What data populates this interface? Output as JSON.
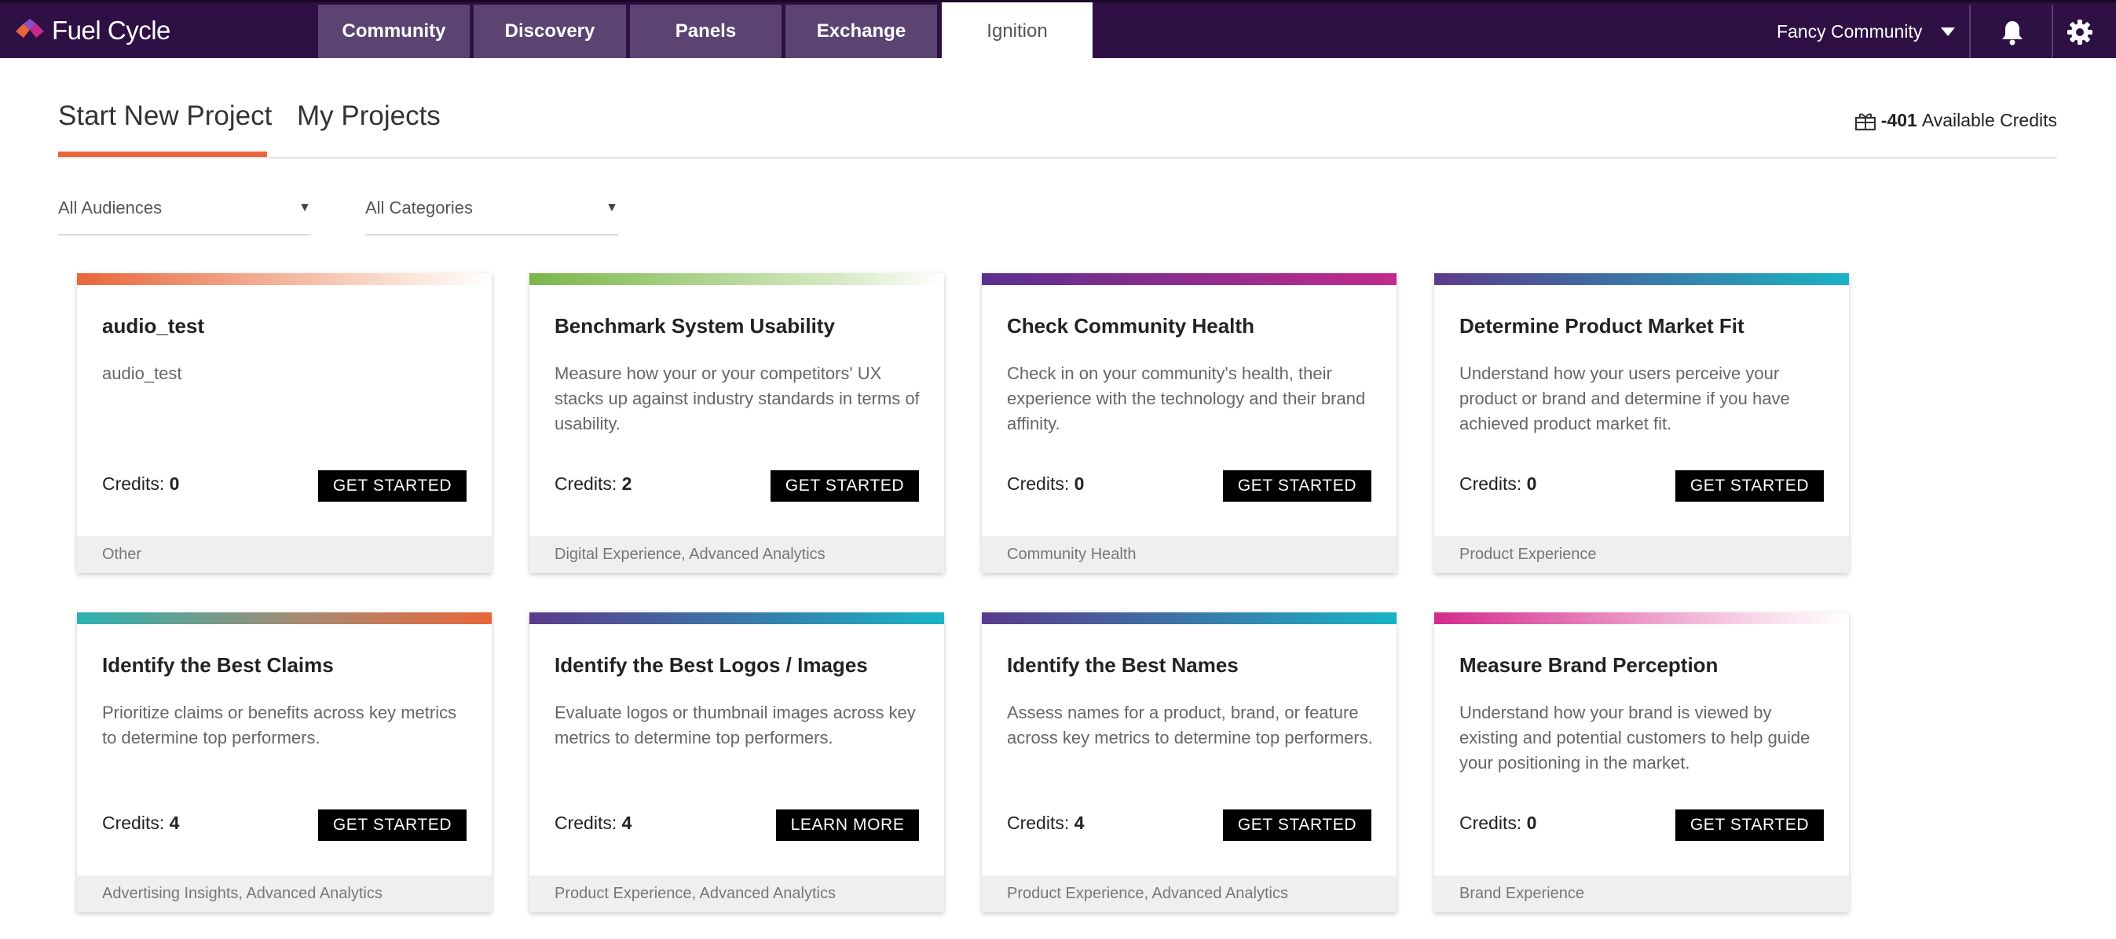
{
  "brand": {
    "name": "Fuel Cycle",
    "logo_icon": "fuel-cycle-logo-icon"
  },
  "nav": {
    "tabs": [
      {
        "label": "Community",
        "active": false
      },
      {
        "label": "Discovery",
        "active": false
      },
      {
        "label": "Panels",
        "active": false
      },
      {
        "label": "Exchange",
        "active": false
      },
      {
        "label": "Ignition",
        "active": true
      }
    ],
    "community_selector": "Fancy Community",
    "icons": [
      "bell-icon",
      "gear-icon"
    ]
  },
  "page": {
    "tabs": [
      {
        "label": "Start New Project",
        "active": true
      },
      {
        "label": "My Projects",
        "active": false
      }
    ],
    "credits": {
      "icon": "gift-icon",
      "value": "-401",
      "label": "Available Credits"
    }
  },
  "filters": {
    "audience": "All Audiences",
    "category": "All Categories"
  },
  "cards": [
    {
      "title": "audio_test",
      "description": "audio_test",
      "credits_label": "Credits:",
      "credits": "0",
      "button": "GET STARTED",
      "categories": "Other"
    },
    {
      "title": "Benchmark System Usability",
      "description": "Measure how your or your competitors' UX stacks up against industry standards in terms of usability.",
      "credits_label": "Credits:",
      "credits": "2",
      "button": "GET STARTED",
      "categories": "Digital Experience, Advanced Analytics"
    },
    {
      "title": "Check Community Health",
      "description": "Check in on your community's health, their experience with the technology and their brand affinity.",
      "credits_label": "Credits:",
      "credits": "0",
      "button": "GET STARTED",
      "categories": "Community Health"
    },
    {
      "title": "Determine Product Market Fit",
      "description": "Understand how your users perceive your product or brand and determine if you have achieved product market fit.",
      "credits_label": "Credits:",
      "credits": "0",
      "button": "GET STARTED",
      "categories": "Product Experience"
    },
    {
      "title": "Identify the Best Claims",
      "description": "Prioritize claims or benefits across key metrics to determine top performers.",
      "credits_label": "Credits:",
      "credits": "4",
      "button": "GET STARTED",
      "categories": "Advertising Insights, Advanced Analytics"
    },
    {
      "title": "Identify the Best Logos / Images",
      "description": "Evaluate logos or thumbnail images across key metrics to determine top performers.",
      "credits_label": "Credits:",
      "credits": "4",
      "button": "LEARN MORE",
      "categories": "Product Experience, Advanced Analytics"
    },
    {
      "title": "Identify the Best Names",
      "description": "Assess names for a product, brand, or feature across key metrics to determine top performers.",
      "credits_label": "Credits:",
      "credits": "4",
      "button": "GET STARTED",
      "categories": "Product Experience, Advanced Analytics"
    },
    {
      "title": "Measure Brand Perception",
      "description": "Understand how your brand is viewed by existing and potential customers to help guide your positioning in the market.",
      "credits_label": "Credits:",
      "credits": "0",
      "button": "GET STARTED",
      "categories": "Brand Experience"
    }
  ],
  "colors": {
    "nav_bg": "#2e1044",
    "nav_tab_bg": "#5b4472",
    "accent_orange": "#e8663a",
    "button_bg": "#000000",
    "card_bars": [
      "linear-gradient(90deg,#e8663a,#fbe4d8 80%,#ffffff)",
      "linear-gradient(90deg,#7ab648,#d7eac4 75%,#ffffff)",
      "linear-gradient(90deg,#5b2f8f,#c22a8c)",
      "linear-gradient(90deg,#5b3b8c,#1ab3c5)",
      "linear-gradient(90deg,#2bb2b0,#a88a70 55%,#e8663a)",
      "linear-gradient(90deg,#5b3b8c,#1ab3c5)",
      "linear-gradient(90deg,#5b3b8c,#1ab3c5)",
      "linear-gradient(90deg,#d42a8c,#f8d2e6 75%,#ffffff)"
    ]
  }
}
